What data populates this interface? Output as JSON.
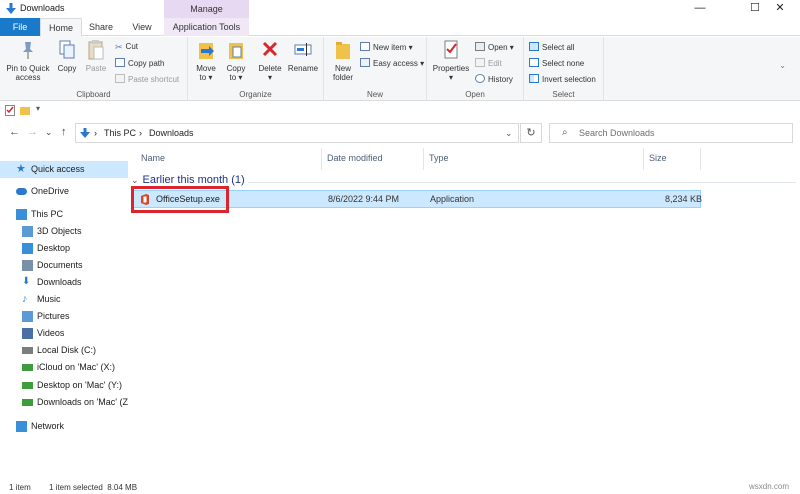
{
  "window": {
    "title": "Downloads",
    "minimize": "—",
    "maximize": "☐",
    "close": "✕"
  },
  "ribbon_tabs": {
    "file": "File",
    "home": "Home",
    "share": "Share",
    "view": "View",
    "manage": "Manage",
    "app_tools": "Application Tools"
  },
  "ribbon": {
    "clipboard": {
      "label": "Clipboard",
      "pin_line1": "Pin to Quick",
      "pin_line2": "access",
      "copy": "Copy",
      "paste": "Paste",
      "cut": "Cut",
      "copy_path": "Copy path",
      "paste_shortcut": "Paste shortcut"
    },
    "organize": {
      "label": "Organize",
      "move_line1": "Move",
      "move_line2": "to ▾",
      "copy_line1": "Copy",
      "copy_line2": "to ▾",
      "delete_line1": "Delete",
      "delete_line2": "▾",
      "rename": "Rename"
    },
    "new": {
      "label": "New",
      "folder_line1": "New",
      "folder_line2": "folder",
      "new_item": "New item ▾",
      "easy_access": "Easy access ▾"
    },
    "open": {
      "label": "Open",
      "properties_line1": "Properties",
      "properties_line2": "▾",
      "open": "Open ▾",
      "edit": "Edit",
      "history": "History"
    },
    "select": {
      "label": "Select",
      "select_all": "Select all",
      "select_none": "Select none",
      "invert": "Invert selection"
    },
    "collapse": "⌄"
  },
  "address": {
    "back": "←",
    "forward": "→",
    "recent": "⌄",
    "up": "↑",
    "crumb_sep1": "›",
    "crumb_this_pc": "This PC",
    "crumb_sep2": "›",
    "crumb_downloads": "Downloads",
    "dropdown": "⌄",
    "refresh": "↻",
    "search_icon": "⌕",
    "search_placeholder": "Search Downloads"
  },
  "nav": [
    {
      "label": "Quick access",
      "icon": "star-icon",
      "color": "#2b78d0"
    },
    {
      "label": "OneDrive",
      "icon": "cloud-icon",
      "color": "#2b78d0"
    },
    {
      "label": "This PC",
      "icon": "computer-icon",
      "color": "#3a8fd9"
    },
    {
      "label": "3D Objects",
      "icon": "cube-icon",
      "color": "#5a9bd5"
    },
    {
      "label": "Desktop",
      "icon": "desktop-folder-icon",
      "color": "#3a8fd9"
    },
    {
      "label": "Documents",
      "icon": "document-icon",
      "color": "#7a8fa8"
    },
    {
      "label": "Downloads",
      "icon": "download-icon",
      "color": "#2b78d0"
    },
    {
      "label": "Music",
      "icon": "music-icon",
      "color": "#3a8fd9"
    },
    {
      "label": "Pictures",
      "icon": "pictures-icon",
      "color": "#5a9bd5"
    },
    {
      "label": "Videos",
      "icon": "videos-icon",
      "color": "#4a6fa5"
    },
    {
      "label": "Local Disk (C:)",
      "icon": "drive-icon",
      "color": "#7c7c7c"
    },
    {
      "label": "iCloud on 'Mac' (X:)",
      "icon": "network-drive-icon",
      "color": "#3e9b3e"
    },
    {
      "label": "Desktop on 'Mac' (Y:)",
      "icon": "network-drive-icon",
      "color": "#3e9b3e"
    },
    {
      "label": "Downloads on 'Mac' (Z",
      "icon": "network-drive-icon",
      "color": "#3e9b3e"
    },
    {
      "label": "Network",
      "icon": "network-icon",
      "color": "#3a8fd9"
    }
  ],
  "columns": {
    "name": "Name",
    "date": "Date modified",
    "type": "Type",
    "size": "Size"
  },
  "group": {
    "label": "Earlier this month (1)"
  },
  "files": [
    {
      "name": "OfficeSetup.exe",
      "date": "8/6/2022 9:44 PM",
      "type": "Application",
      "size": "8,234 KB"
    }
  ],
  "status": {
    "count": "1 item",
    "selected": "1 item selected  8.04 MB"
  },
  "watermark": "wsxdn.com",
  "colors": {
    "accent": "#1979ca",
    "selection": "#cce8ff",
    "highlight_box": "#d9262c"
  }
}
